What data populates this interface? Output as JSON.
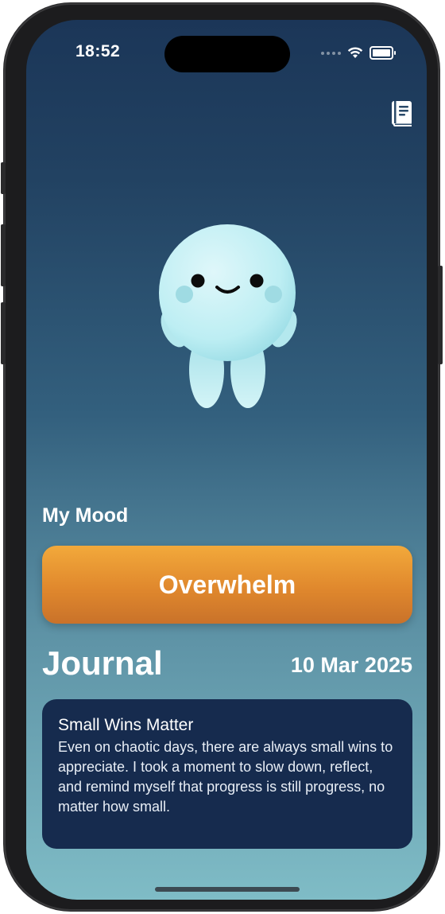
{
  "status_bar": {
    "time": "18:52",
    "icons": [
      "cellular-dots-icon",
      "wifi-icon",
      "battery-icon"
    ]
  },
  "header": {
    "journal_icon": "journal-book-icon"
  },
  "mascot": {
    "name": "mood-character"
  },
  "mood": {
    "section_label": "My Mood",
    "current_mood": "Overwhelm",
    "button_color": "#e0882d"
  },
  "journal": {
    "title": "Journal",
    "date": "10 Mar 2025",
    "entry": {
      "title": "Small Wins Matter",
      "body": "Even on chaotic days, there are always small wins to appreciate. I took a moment to slow down, reflect, and remind myself that progress is still progress, no matter how small."
    }
  },
  "colors": {
    "background_top": "#1b3658",
    "background_bottom": "#7fbcc6",
    "card": "#162b4e"
  }
}
